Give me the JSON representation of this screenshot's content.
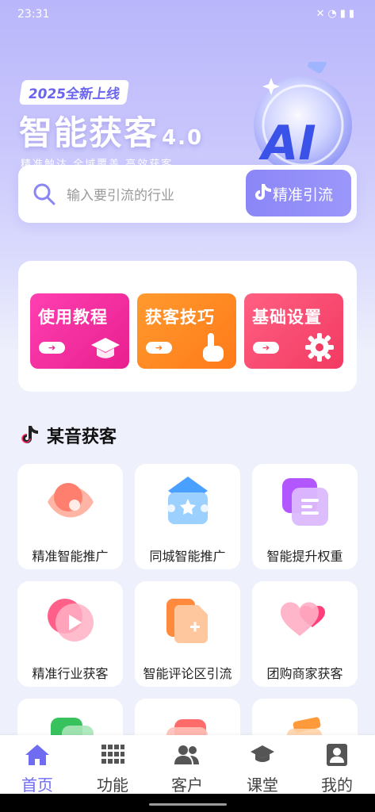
{
  "status_bar": {
    "time": "23:31",
    "icons": [
      "mute-icon",
      "wifi-icon",
      "signal-icon",
      "battery-icon"
    ]
  },
  "banner": {
    "tag": "2025全新上线",
    "headline": "智能获客",
    "version": "4.0",
    "subline": "精准触达 全域覆盖 高效获客",
    "art_label": "AI"
  },
  "search": {
    "placeholder": "输入要引流的行业",
    "button_label": "精准引流"
  },
  "quick_actions": [
    {
      "label": "使用教程",
      "icon": "graduation-cap-icon",
      "arrow": "➔"
    },
    {
      "label": "获客技巧",
      "icon": "tap-hand-icon",
      "arrow": "➔"
    },
    {
      "label": "基础设置",
      "icon": "gear-icon",
      "arrow": "➔"
    }
  ],
  "section": {
    "title": "某音获客",
    "icon": "music-note-icon"
  },
  "features": [
    {
      "label": "精准智能推广",
      "icon": "target-eye-icon"
    },
    {
      "label": "同城智能推广",
      "icon": "star-house-icon"
    },
    {
      "label": "智能提升权重",
      "icon": "document-stack-icon"
    },
    {
      "label": "精准行业获客",
      "icon": "play-circle-icon"
    },
    {
      "label": "智能评论区引流",
      "icon": "add-file-icon"
    },
    {
      "label": "团购商家获客",
      "icon": "hearts-icon"
    },
    {
      "label": "",
      "icon": "green-card-icon"
    },
    {
      "label": "",
      "icon": "red-card-icon"
    },
    {
      "label": "",
      "icon": "orange-pen-icon"
    }
  ],
  "bottom_nav": [
    {
      "label": "首页",
      "icon": "home-icon",
      "active": true
    },
    {
      "label": "功能",
      "icon": "grid-icon",
      "active": false
    },
    {
      "label": "客户",
      "icon": "users-icon",
      "active": false
    },
    {
      "label": "课堂",
      "icon": "graduation-cap-icon",
      "active": false
    },
    {
      "label": "我的",
      "icon": "profile-icon",
      "active": false
    }
  ],
  "colors": {
    "accent": "#6f6cf2",
    "pink": "#e81f8f",
    "orange": "#ff7a1a",
    "red": "#f23a62"
  }
}
